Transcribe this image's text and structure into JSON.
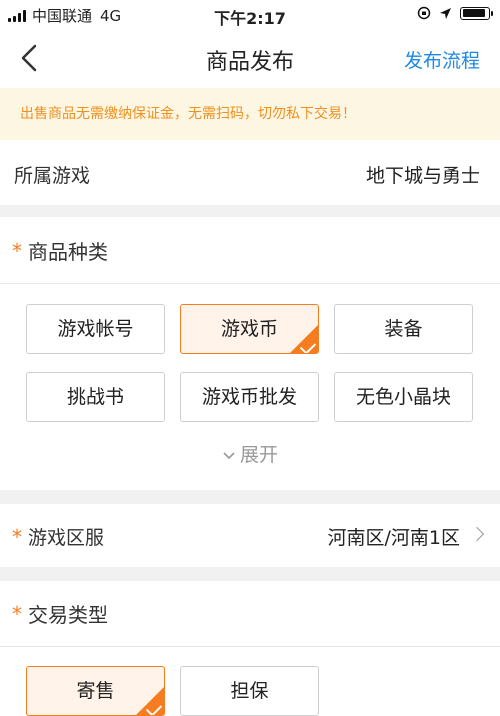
{
  "status_bar": {
    "carrier": "中国联通",
    "network": "4G",
    "time": "下午2:17"
  },
  "nav": {
    "title": "商品发布",
    "right_link": "发布流程"
  },
  "notice": {
    "text": "出售商品无需缴纳保证金，无需扫码，切勿私下交易！"
  },
  "game_row": {
    "label": "所属游戏",
    "value": "地下城与勇士"
  },
  "category": {
    "required_mark": "*",
    "title": "商品种类",
    "options": [
      "游戏帐号",
      "游戏币",
      "装备",
      "挑战书",
      "游戏币批发",
      "无色小晶块"
    ],
    "selected": "游戏币",
    "expand_label": "展开"
  },
  "server_row": {
    "required_mark": "*",
    "label": "游戏区服",
    "value": "河南区/河南1区"
  },
  "trade_type": {
    "required_mark": "*",
    "title": "交易类型",
    "options": [
      "寄售",
      "担保"
    ],
    "selected": "寄售"
  },
  "colors": {
    "accent": "#f57c1f",
    "link": "#1e88e5",
    "notice_bg": "#fdf6e3",
    "notice_text": "#f0901e"
  }
}
